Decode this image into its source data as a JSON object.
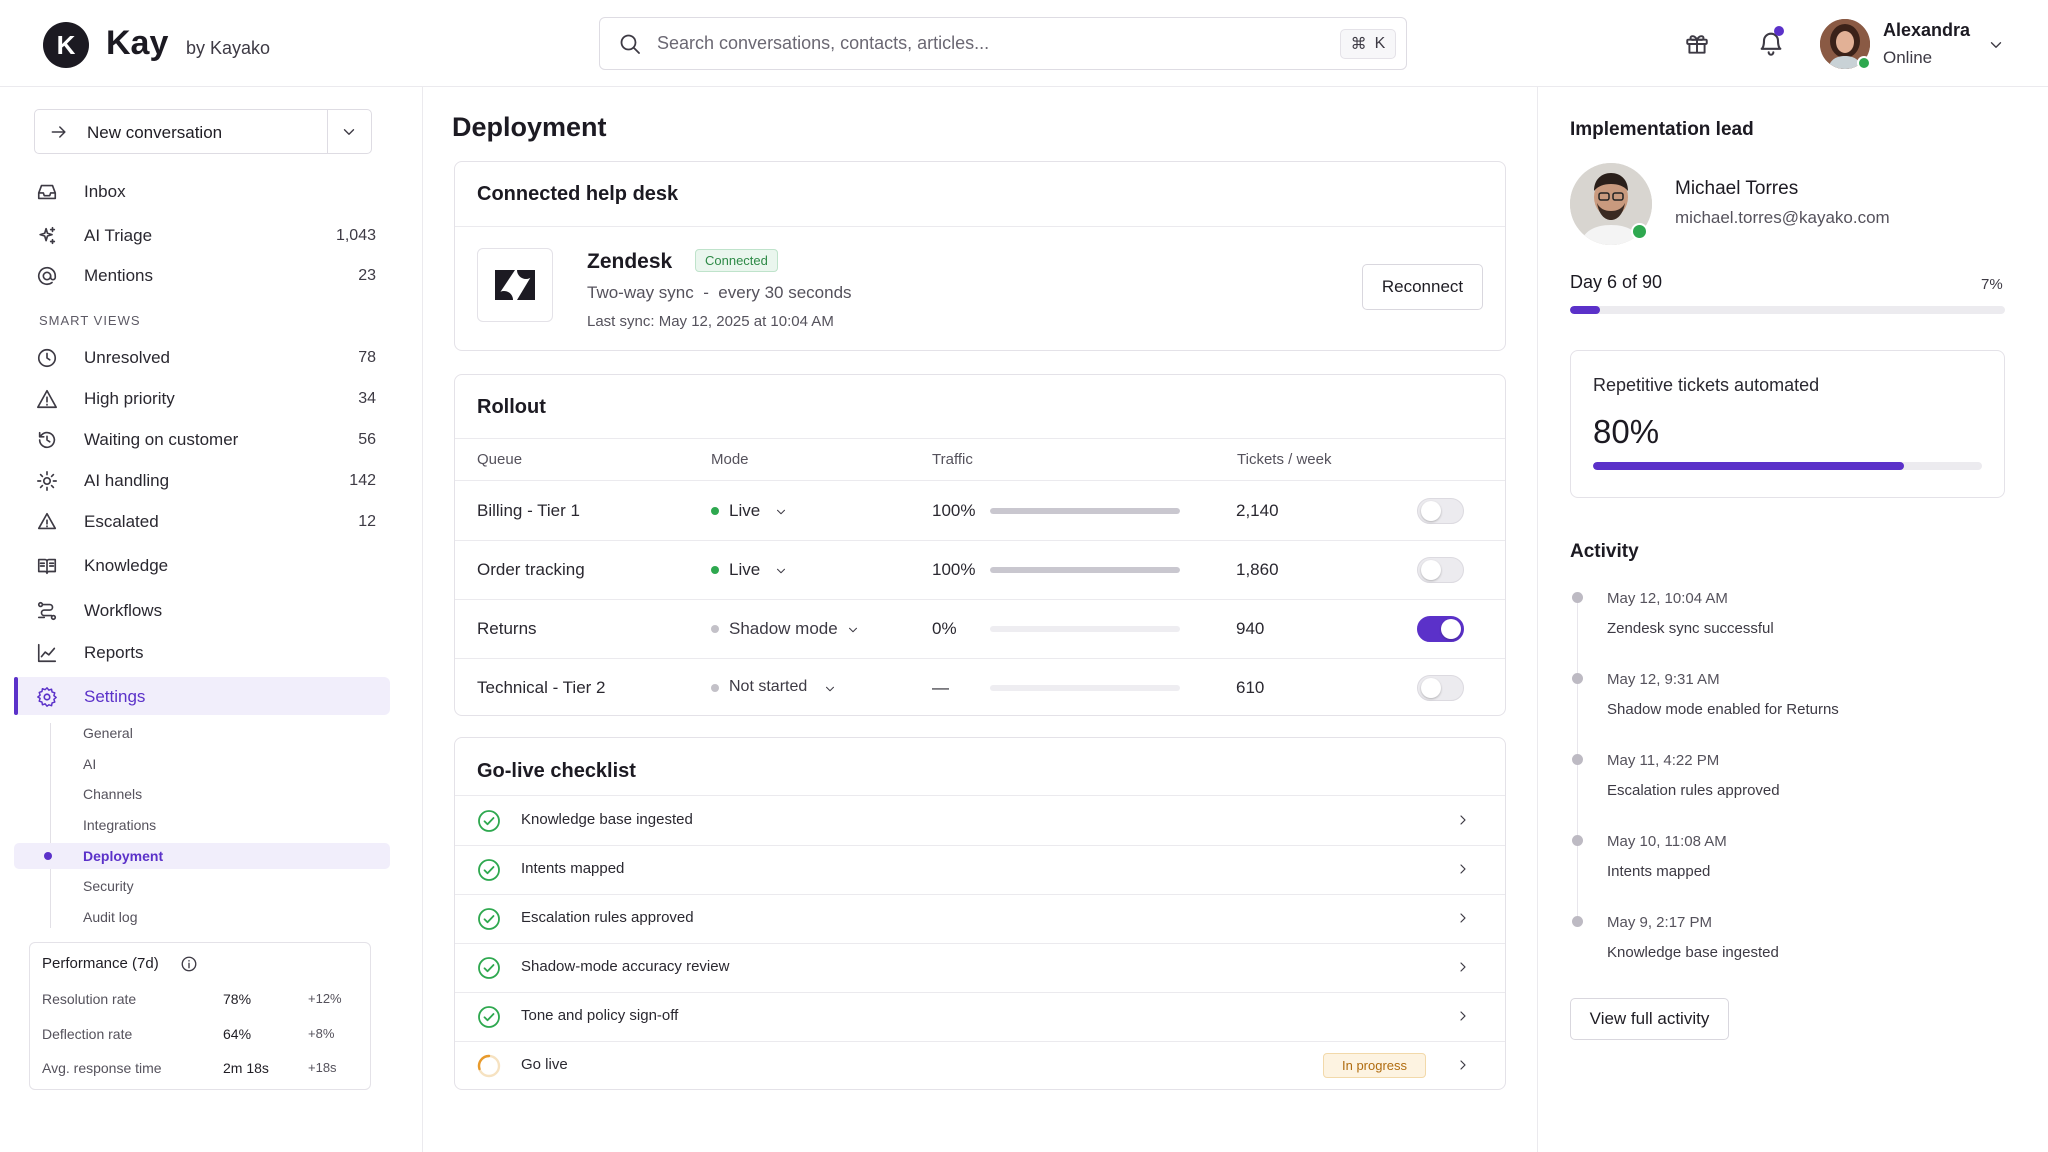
{
  "brand": {
    "logo_letter": "K",
    "name": "Kay",
    "sub": "by Kayako"
  },
  "search": {
    "placeholder": "Search conversations, contacts, articles...",
    "shortcut_cmd": "⌘",
    "shortcut_key": "K"
  },
  "user": {
    "name": "Alexandra",
    "status": "Online"
  },
  "sidebar": {
    "new_conversation": "New conversation",
    "top_items": [
      {
        "label": "Inbox",
        "count": "",
        "icon": "inbox-icon"
      },
      {
        "label": "AI Triage",
        "count": "1,043",
        "icon": "sparkle-icon"
      },
      {
        "label": "Mentions",
        "count": "23",
        "icon": "at-icon"
      }
    ],
    "smart_views_label": "SMART VIEWS",
    "smart_views": [
      {
        "label": "Unresolved",
        "count": "78",
        "icon": "clock-icon"
      },
      {
        "label": "High priority",
        "count": "34",
        "icon": "warning-icon"
      },
      {
        "label": "Waiting on customer",
        "count": "56",
        "icon": "history-icon"
      },
      {
        "label": "AI handling",
        "count": "142",
        "icon": "cog-icon"
      },
      {
        "label": "Escalated",
        "count": "12",
        "icon": "bell-alert-icon"
      }
    ],
    "bottom_items": [
      {
        "label": "Knowledge",
        "icon": "book-icon"
      },
      {
        "label": "Workflows",
        "icon": "workflow-icon"
      },
      {
        "label": "Reports",
        "icon": "chart-icon"
      },
      {
        "label": "Settings",
        "icon": "settings-icon"
      }
    ],
    "settings_sub": [
      "General",
      "AI",
      "Channels",
      "Integrations",
      "Deployment",
      "Security",
      "Audit log"
    ],
    "performance": {
      "title": "Performance (7d)",
      "rows": [
        {
          "label": "Resolution rate",
          "value": "78%",
          "delta": "+12%"
        },
        {
          "label": "Deflection rate",
          "value": "64%",
          "delta": "+8%"
        },
        {
          "label": "Avg. response time",
          "value": "2m 18s",
          "delta": "+18s"
        }
      ]
    }
  },
  "main": {
    "title": "Deployment",
    "helpdesk": {
      "title": "Connected help desk",
      "name": "Zendesk",
      "status": "Connected",
      "sync": "Two-way sync  -  every 30 seconds",
      "last_sync": "Last sync: May 12, 2025 at 10:04 AM",
      "reconnect": "Reconnect"
    },
    "rollout": {
      "title": "Rollout",
      "headers": {
        "queue": "Queue",
        "mode": "Mode",
        "traffic": "Traffic",
        "tickets": "Tickets / week"
      },
      "rows": [
        {
          "queue": "Billing - Tier 1",
          "mode": "Live",
          "mode_color": "#2ea84f",
          "traffic": "100%",
          "traffic_pct": 100,
          "tickets": "2,140",
          "enabled": false
        },
        {
          "queue": "Order tracking",
          "mode": "Live",
          "mode_color": "#2ea84f",
          "traffic": "100%",
          "traffic_pct": 100,
          "tickets": "1,860",
          "enabled": false
        },
        {
          "queue": "Returns",
          "mode": "Shadow mode",
          "mode_color": "#c3c1c8",
          "traffic": "0%",
          "traffic_pct": 0,
          "tickets": "940",
          "enabled": true
        },
        {
          "queue": "Technical - Tier 2",
          "mode": "Not started",
          "mode_color": "#c3c1c8",
          "traffic": "—",
          "traffic_pct": 0,
          "tickets": "610",
          "enabled": false
        }
      ]
    },
    "checklist": {
      "title": "Go-live checklist",
      "items": [
        {
          "label": "Knowledge base ingested",
          "done": true,
          "badge": ""
        },
        {
          "label": "Intents mapped",
          "done": true,
          "badge": ""
        },
        {
          "label": "Escalation rules approved",
          "done": true,
          "badge": ""
        },
        {
          "label": "Shadow-mode accuracy review",
          "done": true,
          "badge": ""
        },
        {
          "label": "Tone and policy sign-off",
          "done": true,
          "badge": ""
        },
        {
          "label": "Go live",
          "done": false,
          "badge": "In progress"
        }
      ]
    }
  },
  "right": {
    "lead_title": "Implementation lead",
    "lead_name": "Michael Torres",
    "lead_email": "michael.torres@kayako.com",
    "day_label": "Day 6 of 90",
    "day_pct_label": "7%",
    "day_progress": 0.07,
    "automated_label": "Repetitive tickets automated",
    "automated_value": "80%",
    "automated_progress": 0.8,
    "activity_title": "Activity",
    "activity": [
      {
        "time": "May 12, 10:04 AM",
        "text": "Zendesk sync successful"
      },
      {
        "time": "May 12, 9:31 AM",
        "text": "Shadow mode enabled for Returns"
      },
      {
        "time": "May 11, 4:22 PM",
        "text": "Escalation rules approved"
      },
      {
        "time": "May 10, 11:08 AM",
        "text": "Intents mapped"
      },
      {
        "time": "May 9, 2:17 PM",
        "text": "Knowledge base ingested"
      }
    ],
    "view_full": "View full activity"
  },
  "colors": {
    "accent": "#5b31c9",
    "success": "#2ea84f",
    "warning": "#e89a2c"
  }
}
